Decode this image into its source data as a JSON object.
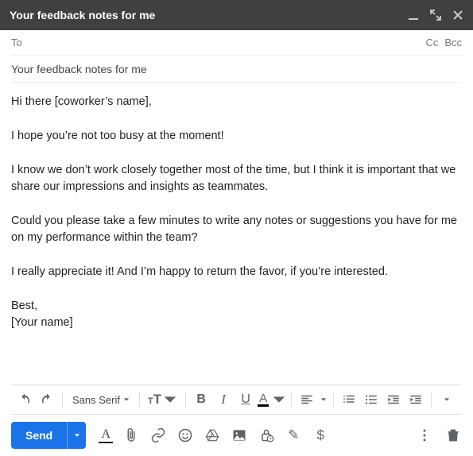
{
  "window": {
    "title": "Your feedback notes for me"
  },
  "recipients": {
    "to_label": "To",
    "to_value": "",
    "cc_label": "Cc",
    "bcc_label": "Bcc"
  },
  "subject": {
    "value": "Your feedback notes for me"
  },
  "body": {
    "paragraphs": [
      "Hi there [coworker’s name],",
      "I hope you’re not too busy at the moment!",
      "I know we don’t work closely together most of the time, but I think it is important that we share our impressions and insights as teammates.",
      "Could you please take a few minutes to write any notes or suggestions you have for me on my performance within the team?",
      "I really appreciate it! And I’m happy to return the favor, if you’re interested.",
      "Best,\n[Your name]"
    ]
  },
  "format_toolbar": {
    "font_family": "Sans Serif",
    "bold": "B",
    "italic": "I",
    "underline": "U",
    "text_color_letter": "A"
  },
  "bottom": {
    "send_label": "Send",
    "text_color_letter": "A",
    "dollar": "$"
  }
}
